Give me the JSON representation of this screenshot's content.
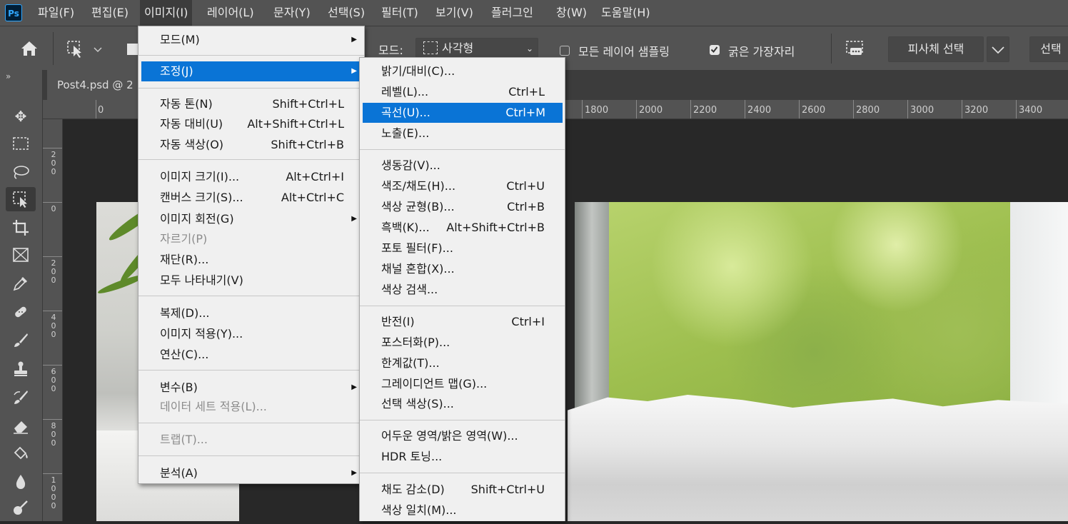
{
  "menubar": {
    "logo": "Ps",
    "items": [
      "파일(F)",
      "편집(E)",
      "이미지(I)",
      "레이어(L)",
      "문자(Y)",
      "선택(S)",
      "필터(T)",
      "보기(V)",
      "플러그인",
      "창(W)",
      "도움말(H)"
    ]
  },
  "options": {
    "mode_label": "모드:",
    "mode_value": "사각형",
    "sample_all_layers": "모든 레이어 샘플링",
    "sample_all_checked": false,
    "hard_edge": "굵은 가장자리",
    "hard_edge_checked": true,
    "select_subject": "피사체 선택",
    "select_btn": "선택"
  },
  "document": {
    "tab_title": "Post4.psd @ 2"
  },
  "ruler": {
    "h_labels": [
      "0",
      "1800",
      "2000",
      "2200",
      "2400",
      "2600",
      "2800",
      "3000",
      "3200",
      "3400"
    ],
    "v_labels": [
      "200",
      "0",
      "200",
      "400",
      "600",
      "800",
      "1000"
    ]
  },
  "image_menu": {
    "items": [
      {
        "label": "모드(M)",
        "shortcut": "",
        "submenu": true
      },
      {
        "label": "조정(J)",
        "shortcut": "",
        "submenu": true,
        "highlight": true
      },
      {
        "label": "자동 톤(N)",
        "shortcut": "Shift+Ctrl+L"
      },
      {
        "label": "자동 대비(U)",
        "shortcut": "Alt+Shift+Ctrl+L"
      },
      {
        "label": "자동 색상(O)",
        "shortcut": "Shift+Ctrl+B"
      },
      {
        "label": "이미지 크기(I)...",
        "shortcut": "Alt+Ctrl+I"
      },
      {
        "label": "캔버스 크기(S)...",
        "shortcut": "Alt+Ctrl+C"
      },
      {
        "label": "이미지 회전(G)",
        "shortcut": "",
        "submenu": true
      },
      {
        "label": "자르기(P)",
        "shortcut": "",
        "disabled": true
      },
      {
        "label": "재단(R)...",
        "shortcut": ""
      },
      {
        "label": "모두 나타내기(V)",
        "shortcut": ""
      },
      {
        "label": "복제(D)...",
        "shortcut": ""
      },
      {
        "label": "이미지 적용(Y)...",
        "shortcut": ""
      },
      {
        "label": "연산(C)...",
        "shortcut": ""
      },
      {
        "label": "변수(B)",
        "shortcut": "",
        "submenu": true
      },
      {
        "label": "데이터 세트 적용(L)...",
        "shortcut": "",
        "disabled": true
      },
      {
        "label": "트랩(T)...",
        "shortcut": "",
        "disabled": true
      },
      {
        "label": "분석(A)",
        "shortcut": "",
        "submenu": true
      }
    ]
  },
  "adjust_menu": {
    "items": [
      {
        "label": "밝기/대비(C)...",
        "shortcut": ""
      },
      {
        "label": "레벨(L)...",
        "shortcut": "Ctrl+L"
      },
      {
        "label": "곡선(U)...",
        "shortcut": "Ctrl+M",
        "highlight": true
      },
      {
        "label": "노출(E)...",
        "shortcut": ""
      },
      {
        "label": "생동감(V)...",
        "shortcut": ""
      },
      {
        "label": "색조/채도(H)...",
        "shortcut": "Ctrl+U"
      },
      {
        "label": "색상 균형(B)...",
        "shortcut": "Ctrl+B"
      },
      {
        "label": "흑백(K)...",
        "shortcut": "Alt+Shift+Ctrl+B"
      },
      {
        "label": "포토 필터(F)...",
        "shortcut": ""
      },
      {
        "label": "채널 혼합(X)...",
        "shortcut": ""
      },
      {
        "label": "색상 검색...",
        "shortcut": ""
      },
      {
        "label": "반전(I)",
        "shortcut": "Ctrl+I"
      },
      {
        "label": "포스터화(P)...",
        "shortcut": ""
      },
      {
        "label": "한계값(T)...",
        "shortcut": ""
      },
      {
        "label": "그레이디언트 맵(G)...",
        "shortcut": ""
      },
      {
        "label": "선택 색상(S)...",
        "shortcut": ""
      },
      {
        "label": "어두운 영역/밝은 영역(W)...",
        "shortcut": ""
      },
      {
        "label": "HDR 토닝...",
        "shortcut": ""
      },
      {
        "label": "채도 감소(D)",
        "shortcut": "Shift+Ctrl+U"
      },
      {
        "label": "색상 일치(M)...",
        "shortcut": ""
      }
    ]
  },
  "tools": [
    "move-tool",
    "marquee-tool",
    "lasso-tool",
    "object-select-tool",
    "crop-tool",
    "frame-tool",
    "eyedropper-tool",
    "healing-tool",
    "brush-tool",
    "stamp-tool",
    "history-brush-tool",
    "eraser-tool",
    "paint-bucket-tool",
    "blur-tool",
    "dodge-tool"
  ],
  "colors": {
    "highlight": "#0a74d6",
    "menu_bg": "#f0f0f0",
    "chrome": "#535353"
  }
}
